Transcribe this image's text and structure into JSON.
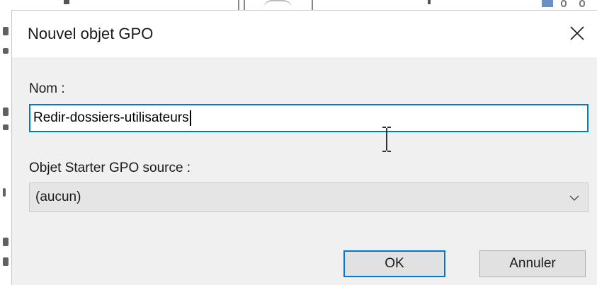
{
  "dialog": {
    "title": "Nouvel objet GPO",
    "close_icon": "close-icon"
  },
  "form": {
    "name_label": "Nom :",
    "name_value": "Redir-dossiers-utilisateurs",
    "starter_label": "Objet Starter GPO source :",
    "starter_selected": "(aucun)"
  },
  "buttons": {
    "ok_label": "OK",
    "cancel_label": "Annuler"
  },
  "colors": {
    "focus_accent": "#0078d7",
    "content_bg": "#f0f0f0",
    "button_bg": "#e1e1e1"
  }
}
